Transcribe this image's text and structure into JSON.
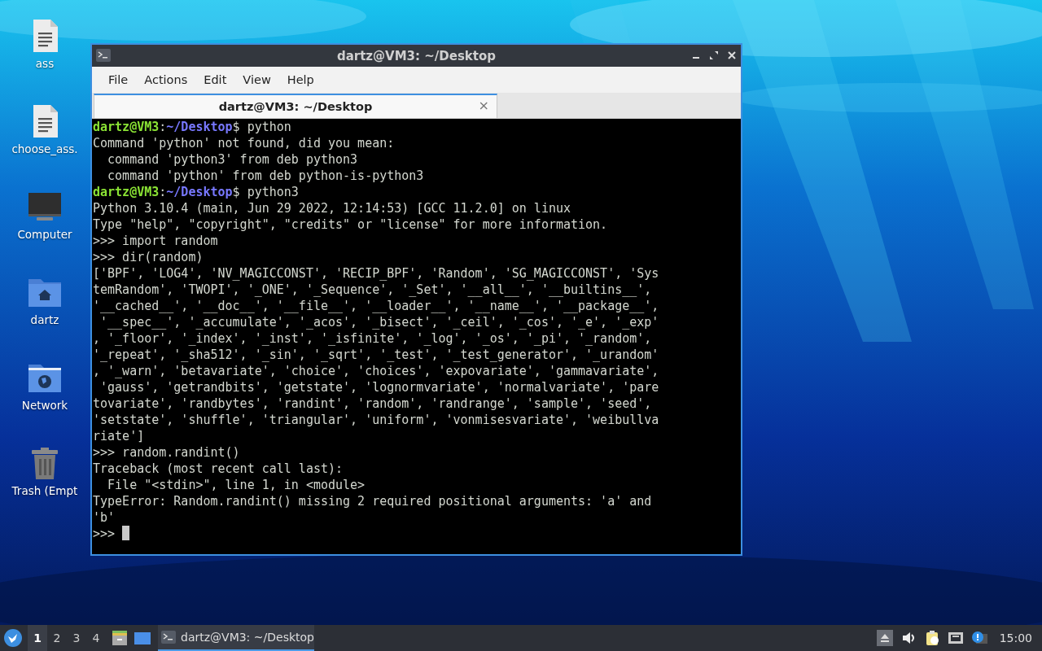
{
  "desktop": {
    "icons": [
      {
        "label": "ass",
        "kind": "document"
      },
      {
        "label": "choose_ass.",
        "kind": "document"
      },
      {
        "label": "Computer",
        "kind": "monitor"
      },
      {
        "label": "dartz",
        "kind": "home-folder"
      },
      {
        "label": "Network",
        "kind": "network-folder"
      },
      {
        "label": "Trash (Empt",
        "kind": "trash"
      }
    ]
  },
  "window": {
    "title": "dartz@VM3: ~/Desktop",
    "menu": [
      "File",
      "Actions",
      "Edit",
      "View",
      "Help"
    ],
    "tabs": [
      {
        "label": "dartz@VM3: ~/Desktop",
        "selected": true,
        "close": "×"
      }
    ],
    "terminal": {
      "lines": [
        {
          "kind": "prompt",
          "user": "dartz@VM3",
          "sep": ":",
          "path": "~/Desktop",
          "symbol": "$",
          "command": "python"
        },
        {
          "kind": "output",
          "text": "Command 'python' not found, did you mean:"
        },
        {
          "kind": "output",
          "text": "  command 'python3' from deb python3"
        },
        {
          "kind": "output",
          "text": "  command 'python' from deb python-is-python3"
        },
        {
          "kind": "prompt",
          "user": "dartz@VM3",
          "sep": ":",
          "path": "~/Desktop",
          "symbol": "$",
          "command": "python3"
        },
        {
          "kind": "output",
          "text": "Python 3.10.4 (main, Jun 29 2022, 12:14:53) [GCC 11.2.0] on linux"
        },
        {
          "kind": "output",
          "text": "Type \"help\", \"copyright\", \"credits\" or \"license\" for more information."
        },
        {
          "kind": "output",
          "text": ">>> import random"
        },
        {
          "kind": "output",
          "text": ">>> dir(random)"
        },
        {
          "kind": "output",
          "text": "['BPF', 'LOG4', 'NV_MAGICCONST', 'RECIP_BPF', 'Random', 'SG_MAGICCONST', 'Sys"
        },
        {
          "kind": "output",
          "text": "temRandom', 'TWOPI', '_ONE', '_Sequence', '_Set', '__all__', '__builtins__',"
        },
        {
          "kind": "output",
          "text": "'__cached__', '__doc__', '__file__', '__loader__', '__name__', '__package__',"
        },
        {
          "kind": "output",
          "text": " '__spec__', '_accumulate', '_acos', '_bisect', '_ceil', '_cos', '_e', '_exp'"
        },
        {
          "kind": "output",
          "text": ", '_floor', '_index', '_inst', '_isfinite', '_log', '_os', '_pi', '_random',"
        },
        {
          "kind": "output",
          "text": "'_repeat', '_sha512', '_sin', '_sqrt', '_test', '_test_generator', '_urandom'"
        },
        {
          "kind": "output",
          "text": ", '_warn', 'betavariate', 'choice', 'choices', 'expovariate', 'gammavariate',"
        },
        {
          "kind": "output",
          "text": " 'gauss', 'getrandbits', 'getstate', 'lognormvariate', 'normalvariate', 'pare"
        },
        {
          "kind": "output",
          "text": "tovariate', 'randbytes', 'randint', 'random', 'randrange', 'sample', 'seed',"
        },
        {
          "kind": "output",
          "text": "'setstate', 'shuffle', 'triangular', 'uniform', 'vonmisesvariate', 'weibullva"
        },
        {
          "kind": "output",
          "text": "riate']"
        },
        {
          "kind": "output",
          "text": ">>> random.randint()"
        },
        {
          "kind": "output",
          "text": "Traceback (most recent call last):"
        },
        {
          "kind": "output",
          "text": "  File \"<stdin>\", line 1, in <module>"
        },
        {
          "kind": "output",
          "text": "TypeError: Random.randint() missing 2 required positional arguments: 'a' and"
        },
        {
          "kind": "output",
          "text": "'b'"
        },
        {
          "kind": "input",
          "text": ">>>",
          "cursor": true
        }
      ]
    }
  },
  "taskbar": {
    "workspaces": [
      {
        "label": "1",
        "selected": true
      },
      {
        "label": "2",
        "selected": false
      },
      {
        "label": "3",
        "selected": false
      },
      {
        "label": "4",
        "selected": false
      }
    ],
    "tasks": [
      {
        "label": "dartz@VM3: ~/Desktop",
        "selected": true
      }
    ],
    "clock": "15:00"
  }
}
